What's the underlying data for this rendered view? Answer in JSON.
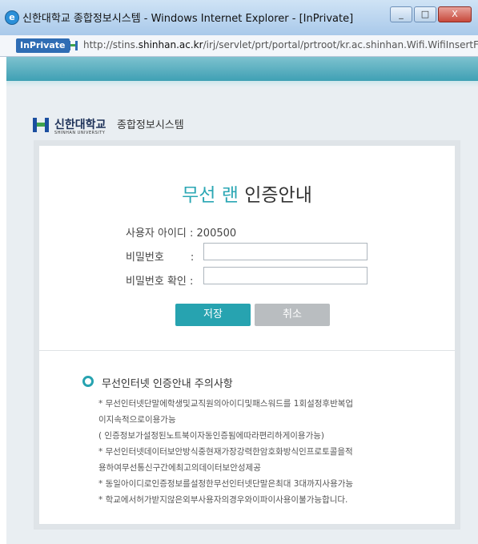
{
  "window": {
    "title": "신한대학교 종합정보시스템 - Windows Internet Explorer - [InPrivate]",
    "minimize": "_",
    "maximize": "□",
    "close": "X"
  },
  "address": {
    "inprivate_label": "InPrivate",
    "url_prefix": "http://stins.",
    "url_domain": "shinhan.ac.kr",
    "url_suffix": "/irj/servlet/prt/portal/prtroot/kr.ac.shinhan.Wifi.WifiInsertForm"
  },
  "brand": {
    "name": "신한대학교",
    "sub": "SHINHAN UNIVERSITY",
    "tagline": "종합정보시스템",
    "colors": {
      "accent": "#27a3b0",
      "navy": "#1b2f57"
    }
  },
  "form": {
    "title_part1": "무선 랜",
    "title_part2": " 인증안내",
    "user_id_label": "사용자 아이디 : 200500",
    "password_label": "비밀번호",
    "password_colon": "        :",
    "password_confirm_label": "비밀번호 확인 :",
    "password_value": "",
    "password_confirm_value": "",
    "save_label": "저장",
    "cancel_label": "취소"
  },
  "notice": {
    "title": "무선인터넷 인증안내 주의사항",
    "items": [
      "* 무선인터넷단말에학생및교직원의아이디및패스워드를 1회설정후반복업",
      "이지속적으로이용가능",
      "( 인증정보가설정된노트북이자동인증됨에따라편리하게이용가능)",
      "* 무선인터넷데이터보안방식중현재가장강력한암호화방식인프로토콜을적",
      "용하여무선통신구간에최고의데이터보안성제공",
      "* 동일아이디로인증정보를설정한무선인터넷단말은최대 3대까지사용가능",
      "* 학교에서허가받지않은외부사용자의경우와이파이사용이불가능합니다."
    ]
  }
}
